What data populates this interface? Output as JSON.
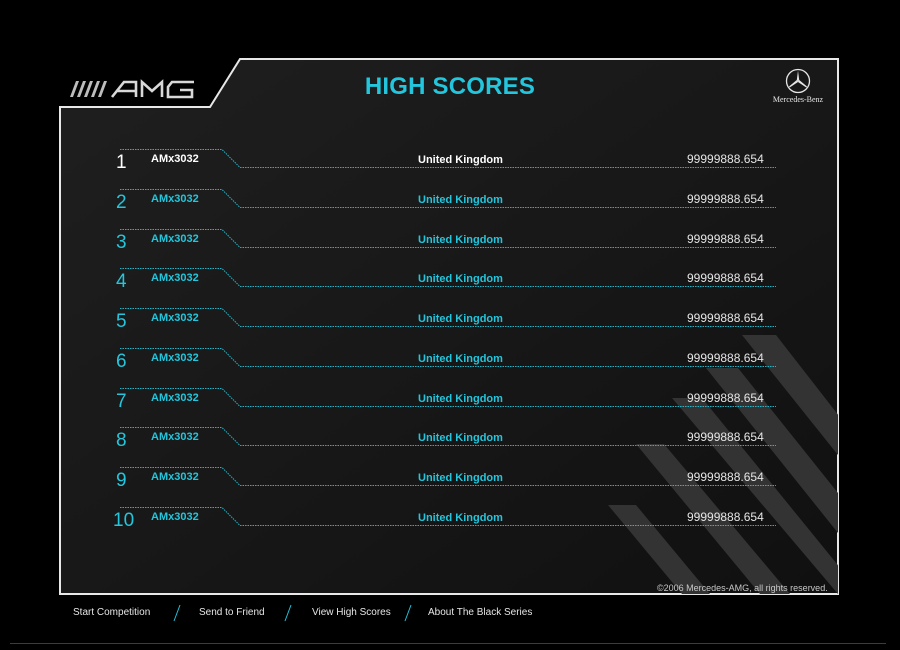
{
  "header": {
    "title": "HIGH SCORES",
    "brand_left": "AMG",
    "brand_right": "Mercedes-Benz"
  },
  "scores": [
    {
      "rank": "1",
      "name": "AMx3032",
      "country": "United Kingdom",
      "score": "99999888.654"
    },
    {
      "rank": "2",
      "name": "AMx3032",
      "country": "United Kingdom",
      "score": "99999888.654"
    },
    {
      "rank": "3",
      "name": "AMx3032",
      "country": "United Kingdom",
      "score": "99999888.654"
    },
    {
      "rank": "4",
      "name": "AMx3032",
      "country": "United Kingdom",
      "score": "99999888.654"
    },
    {
      "rank": "5",
      "name": "AMx3032",
      "country": "United Kingdom",
      "score": "99999888.654"
    },
    {
      "rank": "6",
      "name": "AMx3032",
      "country": "United Kingdom",
      "score": "99999888.654"
    },
    {
      "rank": "7",
      "name": "AMx3032",
      "country": "United Kingdom",
      "score": "99999888.654"
    },
    {
      "rank": "8",
      "name": "AMx3032",
      "country": "United Kingdom",
      "score": "99999888.654"
    },
    {
      "rank": "9",
      "name": "AMx3032",
      "country": "United Kingdom",
      "score": "99999888.654"
    },
    {
      "rank": "10",
      "name": "AMx3032",
      "country": "United Kingdom",
      "score": "99999888.654"
    }
  ],
  "footer": {
    "copyright": "©2006 Mercedes-AMG, all rights reserved."
  },
  "nav": {
    "items": [
      "Start Competition",
      "Send to Friend",
      "View High Scores",
      "About The Black Series"
    ]
  },
  "colors": {
    "accent": "#23c6dc",
    "background": "#000000",
    "panel": "#1c1c1c",
    "text": "#e6e6e6"
  }
}
